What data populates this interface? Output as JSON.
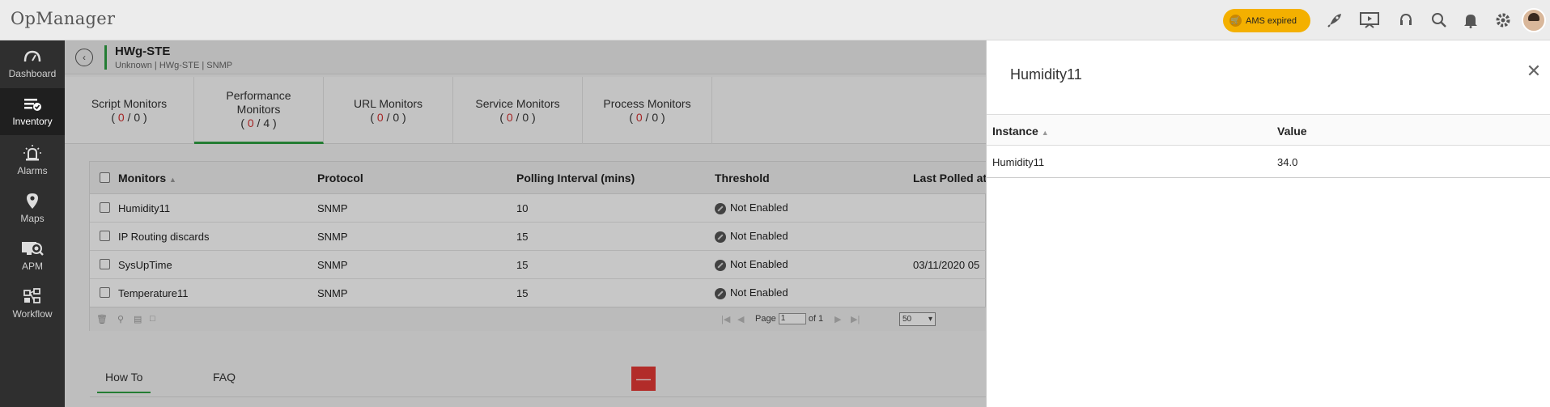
{
  "app": {
    "title": "OpManager",
    "ams_label": "AMS expired"
  },
  "topbar_icons": [
    "rocket-icon",
    "presentation-icon",
    "headset-icon",
    "search-icon",
    "bell-icon",
    "gear-icon"
  ],
  "sidebar": {
    "items": [
      {
        "label": "Dashboard",
        "icon": "speedometer-icon"
      },
      {
        "label": "Inventory",
        "icon": "inventory-list-icon",
        "active": true
      },
      {
        "label": "Alarms",
        "icon": "alarm-light-icon"
      },
      {
        "label": "Maps",
        "icon": "map-pin-icon"
      },
      {
        "label": "APM",
        "icon": "apm-monitor-icon"
      },
      {
        "label": "Workflow",
        "icon": "workflow-icon"
      }
    ]
  },
  "device": {
    "name": "HWg-STE",
    "subtitle": "Unknown | HWg-STE  | SNMP"
  },
  "tabs": [
    {
      "line1": "Script Monitors",
      "line2": "",
      "open": "( ",
      "red": "0",
      "rest": " / 0 )"
    },
    {
      "line1": "Performance",
      "line2": "Monitors",
      "open": "( ",
      "red": "0",
      "rest": " / 4 )",
      "active": true
    },
    {
      "line1": "URL Monitors",
      "line2": "",
      "open": "( ",
      "red": "0",
      "rest": " / 0 )"
    },
    {
      "line1": "Service Monitors",
      "line2": "",
      "open": "( ",
      "red": "0",
      "rest": " / 0 )"
    },
    {
      "line1": "Process Monitors",
      "line2": "",
      "open": "( ",
      "red": "0",
      "rest": " / 0 )"
    }
  ],
  "grid": {
    "columns": [
      "Monitors",
      "Protocol",
      "Polling Interval (mins)",
      "Threshold",
      "Last Polled at"
    ],
    "rows": [
      {
        "monitor": "Humidity11",
        "protocol": "SNMP",
        "interval": "10",
        "threshold": "Not Enabled",
        "last_polled": ""
      },
      {
        "monitor": "IP Routing discards",
        "protocol": "SNMP",
        "interval": "15",
        "threshold": "Not Enabled",
        "last_polled": ""
      },
      {
        "monitor": "SysUpTime",
        "protocol": "SNMP",
        "interval": "15",
        "threshold": "Not Enabled",
        "last_polled": "03/11/2020 05"
      },
      {
        "monitor": "Temperature11",
        "protocol": "SNMP",
        "interval": "15",
        "threshold": "Not Enabled",
        "last_polled": ""
      }
    ],
    "pager": {
      "page_label": "Page",
      "page_value": "1",
      "of_label": "of 1",
      "per_page": "50"
    }
  },
  "help_tabs": {
    "howto": "How To",
    "faq": "FAQ",
    "minimize": "—"
  },
  "panel": {
    "title": "Humidity11",
    "columns": [
      "Instance",
      "Value"
    ],
    "rows": [
      {
        "instance": "Humidity11",
        "value": "34.0"
      }
    ]
  }
}
